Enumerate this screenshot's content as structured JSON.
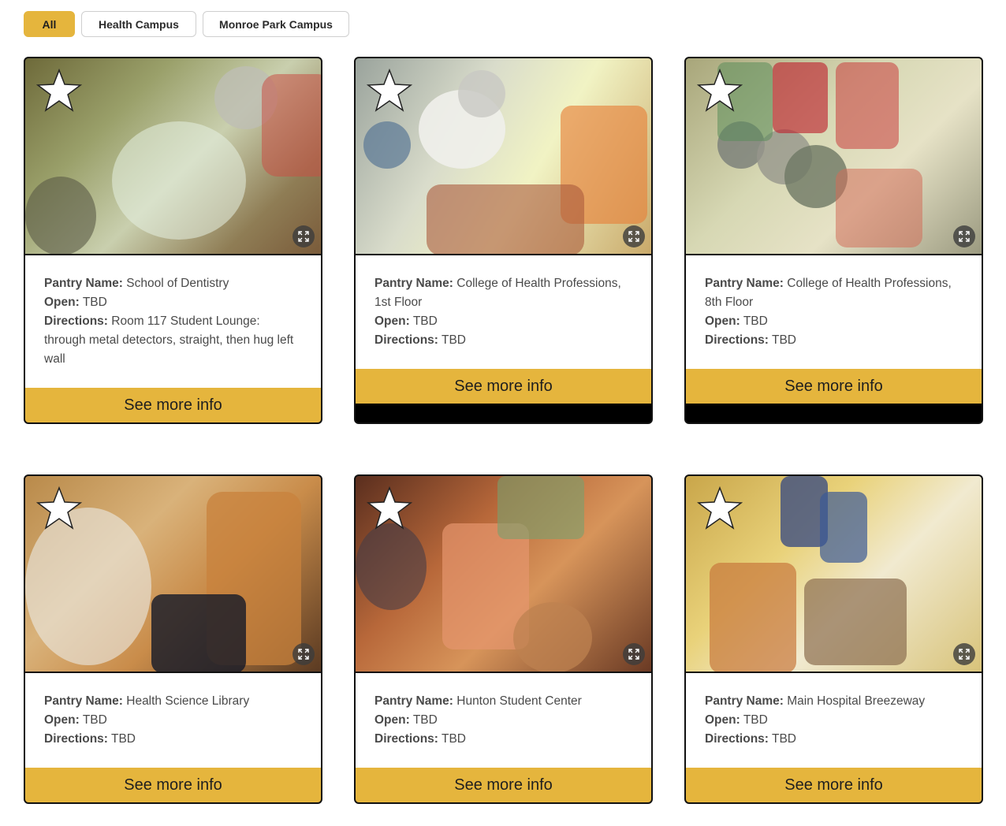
{
  "filters": [
    {
      "label": "All",
      "active": true
    },
    {
      "label": "Health Campus",
      "active": false
    },
    {
      "label": "Monroe Park Campus",
      "active": false
    }
  ],
  "labels": {
    "pantry_name": "Pantry Name:",
    "open": "Open:",
    "directions": "Directions:",
    "more_button": "See more info"
  },
  "cards": [
    {
      "name": "School of Dentistry",
      "open": "TBD",
      "directions": "Room 117 Student Lounge: through metal detectors, straight, then hug left wall",
      "photo_icons": [
        "star-icon",
        "expand-icon"
      ]
    },
    {
      "name": "College of Health Professions, 1st Floor",
      "open": "TBD",
      "directions": "TBD",
      "photo_icons": [
        "star-icon",
        "expand-icon"
      ]
    },
    {
      "name": "College of Health Professions, 8th Floor",
      "open": "TBD",
      "directions": "TBD",
      "photo_icons": [
        "star-icon",
        "expand-icon"
      ]
    },
    {
      "name": "Health Science Library",
      "open": "TBD",
      "directions": "TBD",
      "photo_icons": [
        "star-icon",
        "expand-icon"
      ]
    },
    {
      "name": "Hunton Student Center",
      "open": "TBD",
      "directions": "TBD",
      "photo_icons": [
        "star-icon",
        "expand-icon"
      ]
    },
    {
      "name": "Main Hospital Breezeway",
      "open": "TBD",
      "directions": "TBD",
      "photo_icons": [
        "star-icon",
        "expand-icon"
      ]
    }
  ],
  "colors": {
    "accent": "#e5b53d",
    "card_border": "#111111",
    "text": "#4a4a4a"
  }
}
